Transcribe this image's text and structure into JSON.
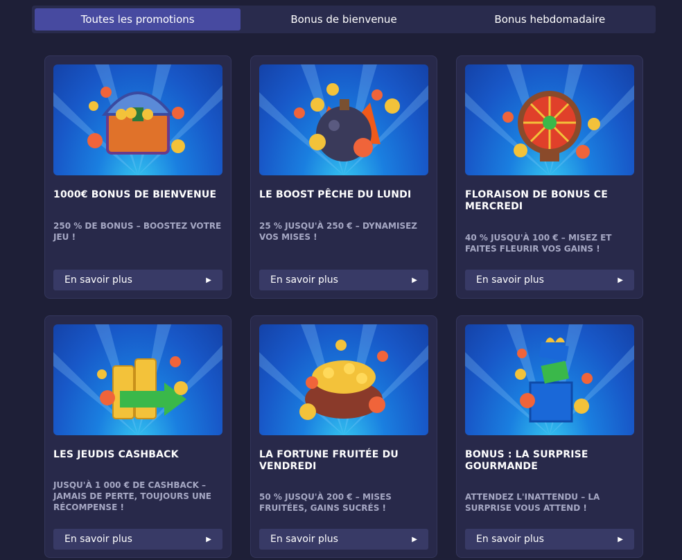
{
  "tabs": [
    {
      "label": "Toutes les promotions",
      "active": true
    },
    {
      "label": "Bonus de bienvenue",
      "active": false
    },
    {
      "label": "Bonus hebdomadaire",
      "active": false
    }
  ],
  "cards": [
    {
      "title": "1000€ BONUS DE BIENVENUE",
      "description": "250 % DE BONUS – BOOSTEZ VOTRE JEU !",
      "button": "En savoir plus",
      "icon": "treasure-chest-icon"
    },
    {
      "title": "LE BOOST PÊCHE DU LUNDI",
      "description": "25 % JUSQU'À 250 € – DYNAMISEZ VOS MISES !",
      "button": "En savoir plus",
      "icon": "bomb-icon"
    },
    {
      "title": "FLORAISON DE BONUS CE MERCREDI",
      "description": "40 % JUSQU'À 100 € – MISEZ ET FAITES FLEURIR VOS GAINS !",
      "button": "En savoir plus",
      "icon": "wheel-icon"
    },
    {
      "title": "LES JEUDIS CASHBACK",
      "description": "JUSQU'À 1 000 € DE CASHBACK – JAMAIS DE PERTE, TOUJOURS UNE RÉCOMPENSE !",
      "button": "En savoir plus",
      "icon": "coins-arrow-icon"
    },
    {
      "title": "LA FORTUNE FRUITÉE DU VENDREDI",
      "description": "50 % JUSQU'À 200 € – MISES FRUITÉES, GAINS SUCRÉS !",
      "button": "En savoir plus",
      "icon": "money-bag-icon"
    },
    {
      "title": "BONUS : LA SURPRISE GOURMANDE",
      "description": "ATTENDEZ L'INATTENDU – LA SURPRISE VOUS ATTEND !",
      "button": "En savoir plus",
      "icon": "gift-box-icon"
    }
  ],
  "colors": {
    "background": "#1e1f37",
    "card": "#28294a",
    "tab_active": "#474aa0",
    "button": "#383a66",
    "description_text": "#a6a8c4"
  }
}
